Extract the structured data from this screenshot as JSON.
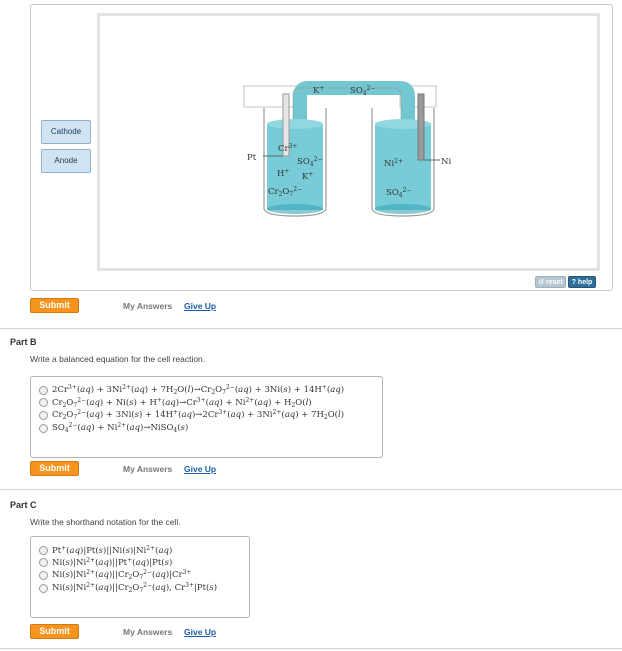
{
  "simulation": {
    "cathode_label": "Cathode",
    "anode_label": "Anode",
    "reset_label": "reset",
    "help_label": "help",
    "electrode_left": "Pt",
    "electrode_right": "Ni",
    "salt_bridge": {
      "k": "K",
      "k_charge": "+",
      "so4": "SO",
      "so4_sub": "4",
      "so4_charge": "2−"
    },
    "left_ions": {
      "cr": "Cr",
      "cr_charge": "3+",
      "so4": "SO",
      "so4_sub": "4",
      "so4_charge": "2−",
      "h": "H",
      "h_charge": "+",
      "k": "K",
      "k_charge": "+",
      "cr2o7": "Cr",
      "cr2o7_sub1": "2",
      "cr2o7_o": "O",
      "cr2o7_sub2": "7",
      "cr2o7_charge": "2−"
    },
    "right_ions": {
      "ni": "Ni",
      "ni_charge": "2+",
      "so4": "SO",
      "so4_sub": "4",
      "so4_charge": "2−"
    },
    "colors": {
      "solution": "#5fc3d0",
      "solution_dark": "#3aa5b5",
      "bridge": "#72c7d2"
    }
  },
  "part_a_actions": {
    "submit": "Submit",
    "my_answers": "My Answers",
    "give_up": "Give Up"
  },
  "part_b": {
    "title": "Part B",
    "prompt": "Write a balanced equation for the cell reaction.",
    "submit": "Submit",
    "my_answers": "My Answers",
    "give_up": "Give Up"
  },
  "part_c": {
    "title": "Part C",
    "prompt": "Write the shorthand notation for the cell.",
    "submit": "Submit",
    "my_answers": "My Answers",
    "give_up": "Give Up"
  },
  "colors": {
    "submit": "#f7941d",
    "link": "#1b5ea8",
    "help": "#2f6f9a"
  }
}
